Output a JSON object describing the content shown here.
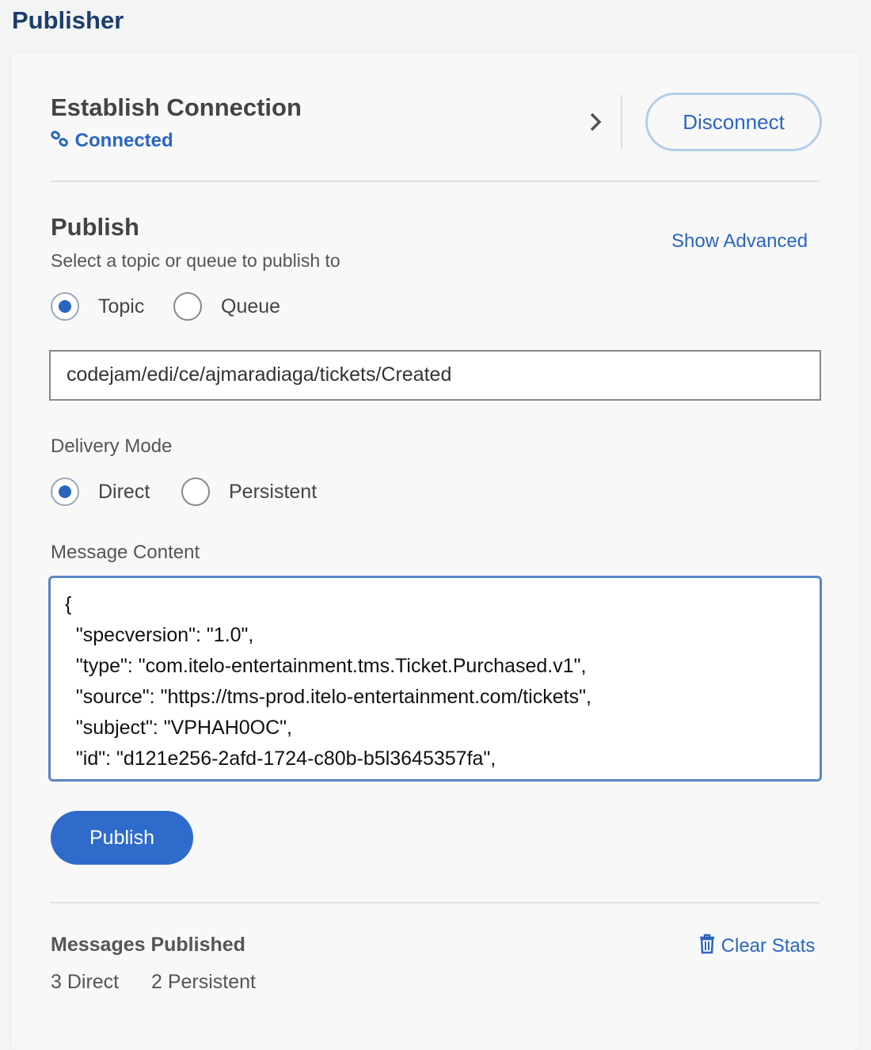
{
  "page": {
    "title": "Publisher"
  },
  "connection": {
    "heading": "Establish Connection",
    "status": "Connected",
    "disconnect_label": "Disconnect"
  },
  "publish": {
    "heading": "Publish",
    "subtitle": "Select a topic or queue to publish to",
    "show_advanced": "Show Advanced",
    "destination_options": [
      {
        "label": "Topic",
        "selected": true
      },
      {
        "label": "Queue",
        "selected": false
      }
    ],
    "destination_value": "codejam/edi/ce/ajmaradiaga/tickets/Created",
    "delivery_mode_label": "Delivery Mode",
    "delivery_options": [
      {
        "label": "Direct",
        "selected": true
      },
      {
        "label": "Persistent",
        "selected": false
      }
    ],
    "message_content_label": "Message Content",
    "message_content": "{\n  \"specversion\": \"1.0\",\n  \"type\": \"com.itelo-entertainment.tms.Ticket.Purchased.v1\",\n  \"source\": \"https://tms-prod.itelo-entertainment.com/tickets\",\n  \"subject\": \"VPHAH0OC\",\n  \"id\": \"d121e256-2afd-1724-c80b-b5l3645357fa\",",
    "publish_label": "Publish"
  },
  "stats": {
    "heading": "Messages Published",
    "clear_label": "Clear Stats",
    "direct": "3 Direct",
    "persistent": "2 Persistent"
  },
  "colors": {
    "accent": "#2f6bcb",
    "title": "#1b3d6d"
  }
}
